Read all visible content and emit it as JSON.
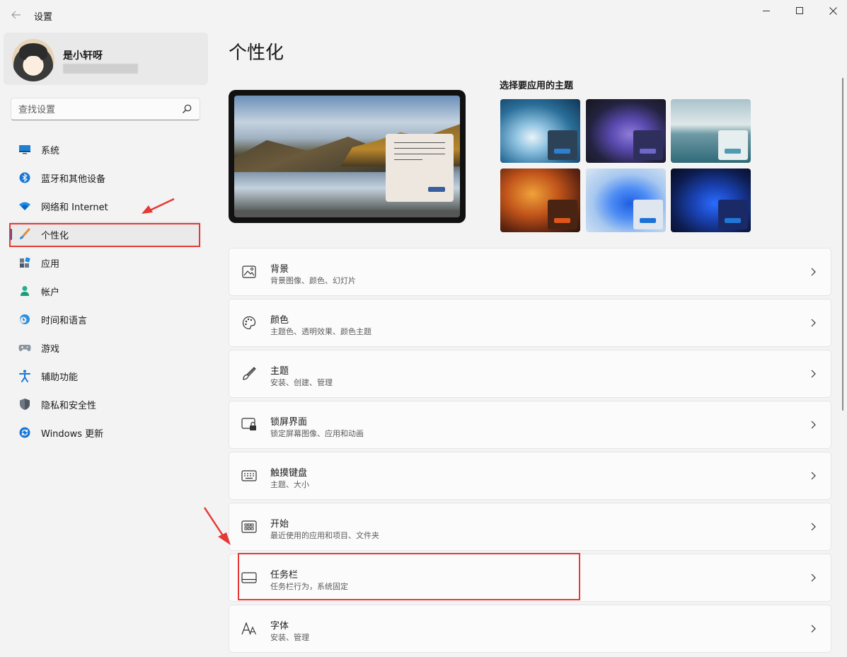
{
  "window": {
    "title": "设置",
    "back_icon": "back-arrow-icon",
    "minimize_icon": "minimize-icon",
    "maximize_icon": "maximize-icon",
    "close_icon": "close-icon"
  },
  "profile": {
    "name": "是小轩呀"
  },
  "search": {
    "placeholder": "查找设置"
  },
  "sidebar": {
    "items": [
      {
        "label": "系统",
        "icon": "monitor-icon"
      },
      {
        "label": "蓝牙和其他设备",
        "icon": "bluetooth-icon"
      },
      {
        "label": "网络和 Internet",
        "icon": "wifi-icon"
      },
      {
        "label": "个性化",
        "icon": "brush-icon",
        "active": true
      },
      {
        "label": "应用",
        "icon": "apps-icon"
      },
      {
        "label": "帐户",
        "icon": "person-icon"
      },
      {
        "label": "时间和语言",
        "icon": "globe-clock-icon"
      },
      {
        "label": "游戏",
        "icon": "gamepad-icon"
      },
      {
        "label": "辅助功能",
        "icon": "accessibility-icon"
      },
      {
        "label": "隐私和安全性",
        "icon": "shield-icon"
      },
      {
        "label": "Windows 更新",
        "icon": "update-icon"
      }
    ]
  },
  "main": {
    "title": "个性化",
    "themes_label": "选择要应用的主题",
    "themes": [
      {
        "name": "theme-glow",
        "chip_color": "#2b4257",
        "button_color": "#2f7fd1"
      },
      {
        "name": "theme-bloom-dark",
        "chip_color": "#2f2f5e",
        "button_color": "#6f66c9"
      },
      {
        "name": "theme-lake",
        "chip_color": "#e6eef0",
        "button_color": "#4f9bb0"
      },
      {
        "name": "theme-autumn",
        "chip_color": "#4a2412",
        "button_color": "#e0561a"
      },
      {
        "name": "theme-bloom-light",
        "chip_color": "#dfe6ef",
        "button_color": "#1b72d6"
      },
      {
        "name": "theme-bloom-blue",
        "chip_color": "#1a2a66",
        "button_color": "#1f78d8"
      }
    ],
    "settings": [
      {
        "title": "背景",
        "subtitle": "背景图像、颜色、幻灯片",
        "icon": "image-icon"
      },
      {
        "title": "颜色",
        "subtitle": "主题色、透明效果、颜色主题",
        "icon": "palette-icon"
      },
      {
        "title": "主题",
        "subtitle": "安装、创建、管理",
        "icon": "brush-icon"
      },
      {
        "title": "锁屏界面",
        "subtitle": "锁定屏幕图像、应用和动画",
        "icon": "lock-screen-icon"
      },
      {
        "title": "触摸键盘",
        "subtitle": "主题、大小",
        "icon": "keyboard-icon"
      },
      {
        "title": "开始",
        "subtitle": "最近使用的应用和项目、文件夹",
        "icon": "start-icon"
      },
      {
        "title": "任务栏",
        "subtitle": "任务栏行为，系统固定",
        "icon": "taskbar-icon"
      },
      {
        "title": "字体",
        "subtitle": "安装、管理",
        "icon": "font-icon"
      }
    ]
  },
  "colors": {
    "accent": "#2a5db8",
    "annotation": "#e53935"
  }
}
